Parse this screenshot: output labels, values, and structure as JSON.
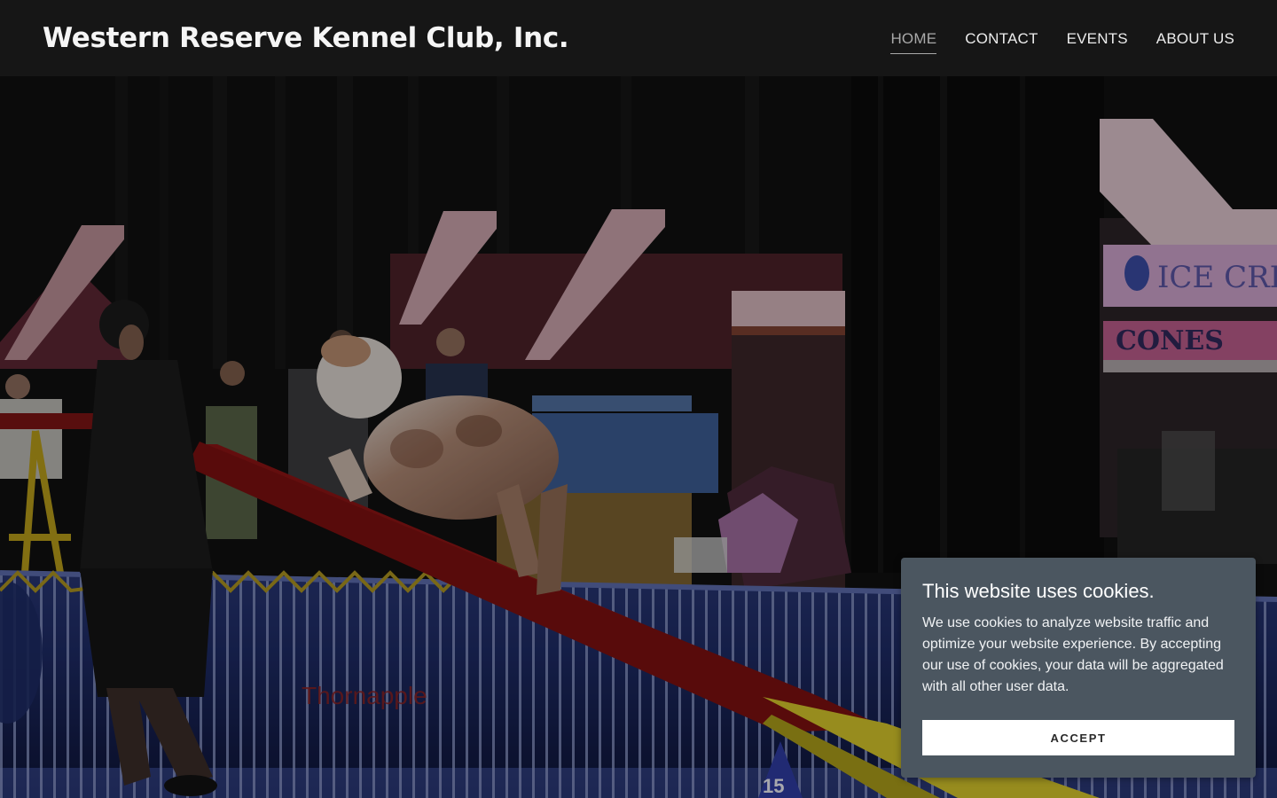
{
  "header": {
    "site_title": "Western Reserve Kennel Club, Inc.",
    "nav": [
      {
        "label": "HOME",
        "active": true
      },
      {
        "label": "CONTACT"
      },
      {
        "label": "EVENTS"
      },
      {
        "label": "ABOUT US"
      }
    ]
  },
  "hero": {
    "image_label": "Thornapple",
    "cone_number": "15",
    "banner_text": "CONES",
    "banner_text_top": "ICE CREAM"
  },
  "cookie_banner": {
    "title": "This website uses cookies.",
    "body": "We use cookies to analyze website traffic and optimize your website experience. By accepting our use of cookies, your data will be aggregated with all other user data.",
    "accept_label": "ACCEPT"
  },
  "colors": {
    "header_bg": "#161616",
    "cookie_bg": "#4b5660",
    "nav_active": "#a9a9a9"
  }
}
